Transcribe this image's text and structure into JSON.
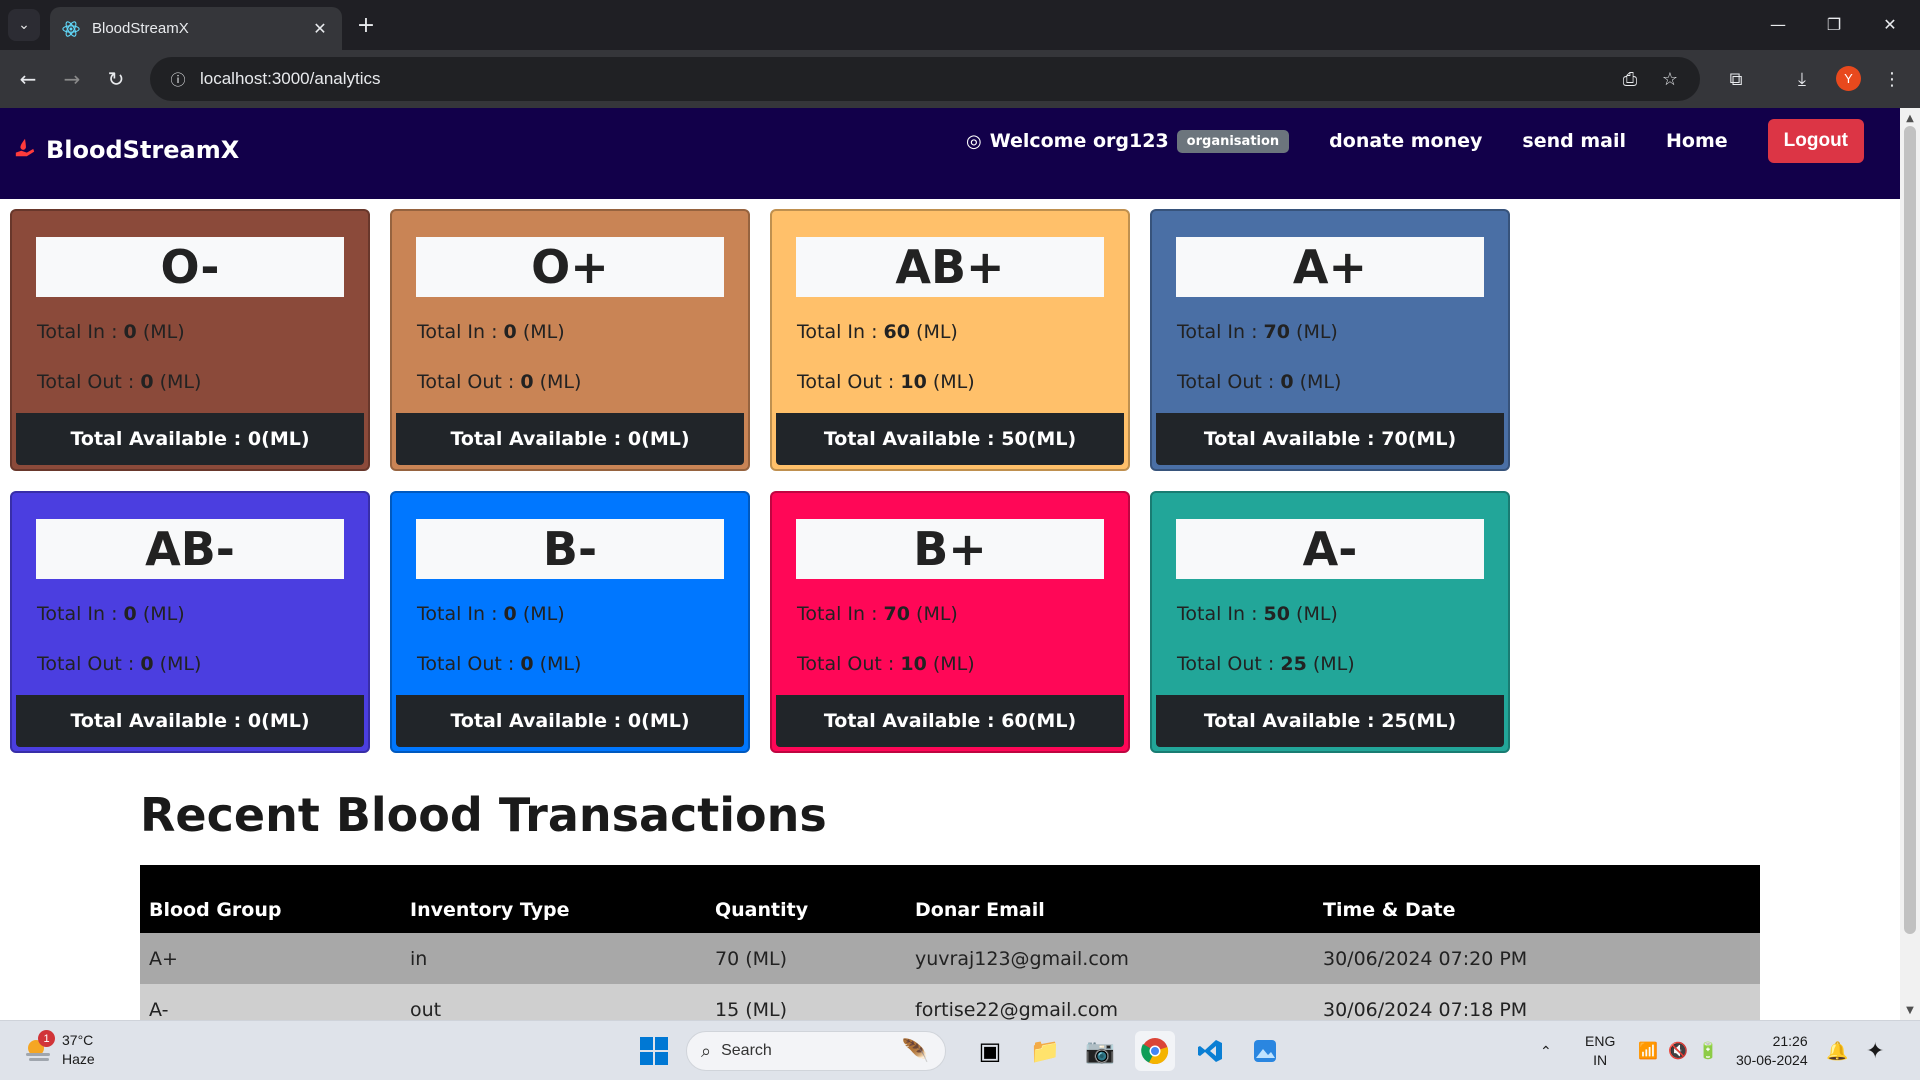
{
  "browser": {
    "tab_title": "BloodStreamX",
    "url": "localhost:3000/analytics",
    "profile_initial": "Y"
  },
  "app": {
    "brand": "BloodStreamX",
    "welcome_text": "Welcome org123",
    "role_badge": "organisation",
    "nav_links": [
      "donate money",
      "send mail",
      "Home"
    ],
    "logout_label": "Logout"
  },
  "labels": {
    "total_in": "Total In : ",
    "total_out": "Total Out : ",
    "total_available": "Total Available : ",
    "unit": " (ML)"
  },
  "blood_cards": [
    {
      "group": "O-",
      "in": "0",
      "out": "0",
      "available": "0",
      "color": "#8b4a3a"
    },
    {
      "group": "O+",
      "in": "0",
      "out": "0",
      "available": "0",
      "color": "#c98455"
    },
    {
      "group": "AB+",
      "in": "60",
      "out": "10",
      "available": "50",
      "color": "#ffc06a"
    },
    {
      "group": "A+",
      "in": "70",
      "out": "0",
      "available": "70",
      "color": "#4a6fa5"
    },
    {
      "group": "AB-",
      "in": "0",
      "out": "0",
      "available": "0",
      "color": "#4b3ee0"
    },
    {
      "group": "B-",
      "in": "0",
      "out": "0",
      "available": "0",
      "color": "#0077ff"
    },
    {
      "group": "B+",
      "in": "70",
      "out": "10",
      "available": "60",
      "color": "#ff0757"
    },
    {
      "group": "A-",
      "in": "50",
      "out": "25",
      "available": "25",
      "color": "#22a699"
    }
  ],
  "transactions": {
    "title": "Recent Blood Transactions",
    "headers": [
      "Blood Group",
      "Inventory Type",
      "Quantity",
      "Donar Email",
      "Time & Date"
    ],
    "rows": [
      [
        "A+",
        "in",
        "70 (ML)",
        "yuvraj123@gmail.com",
        "30/06/2024 07:20 PM"
      ],
      [
        "A-",
        "out",
        "15 (ML)",
        "fortise22@gmail.com",
        "30/06/2024 07:18 PM"
      ]
    ]
  },
  "taskbar": {
    "weather_temp": "37°C",
    "weather_desc": "Haze",
    "weather_badge": "1",
    "search_placeholder": "Search",
    "lang_line1": "ENG",
    "lang_line2": "IN",
    "time": "21:26",
    "date": "30-06-2024"
  }
}
